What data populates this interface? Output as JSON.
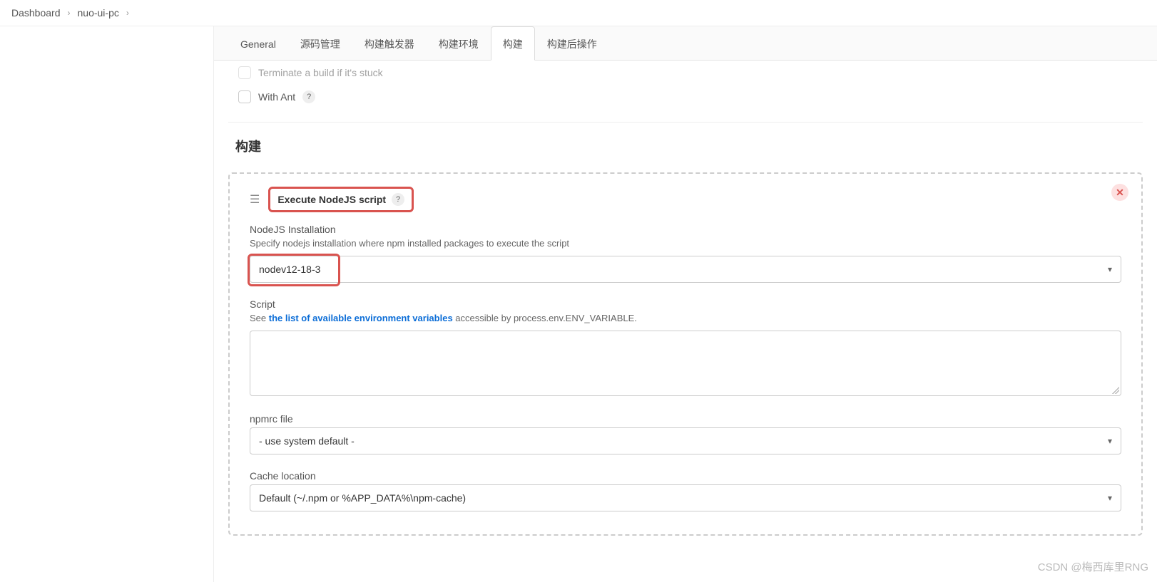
{
  "breadcrumb": {
    "items": [
      "Dashboard",
      "nuo-ui-pc"
    ]
  },
  "tabs": {
    "items": [
      "General",
      "源码管理",
      "构建触发器",
      "构建环境",
      "构建",
      "构建后操作"
    ],
    "active_index": 4
  },
  "env_checks": {
    "terminate": "Terminate a build if it's stuck",
    "with_ant": "With Ant"
  },
  "section": {
    "build_title": "构建"
  },
  "step": {
    "title": "Execute NodeJS script",
    "nodejs_install_label": "NodeJS Installation",
    "nodejs_install_help": "Specify nodejs installation where npm installed packages to execute the script",
    "nodejs_install_value": "nodev12-18-3",
    "script_label": "Script",
    "script_help_prefix": "See ",
    "script_help_link": "the list of available environment variables",
    "script_help_suffix": " accessible by process.env.ENV_VARIABLE.",
    "script_value": "",
    "npmrc_label": "npmrc file",
    "npmrc_value": "- use system default -",
    "cache_label": "Cache location",
    "cache_value": "Default (~/.npm or %APP_DATA%\\npm-cache)"
  },
  "watermark": "CSDN @梅西库里RNG"
}
